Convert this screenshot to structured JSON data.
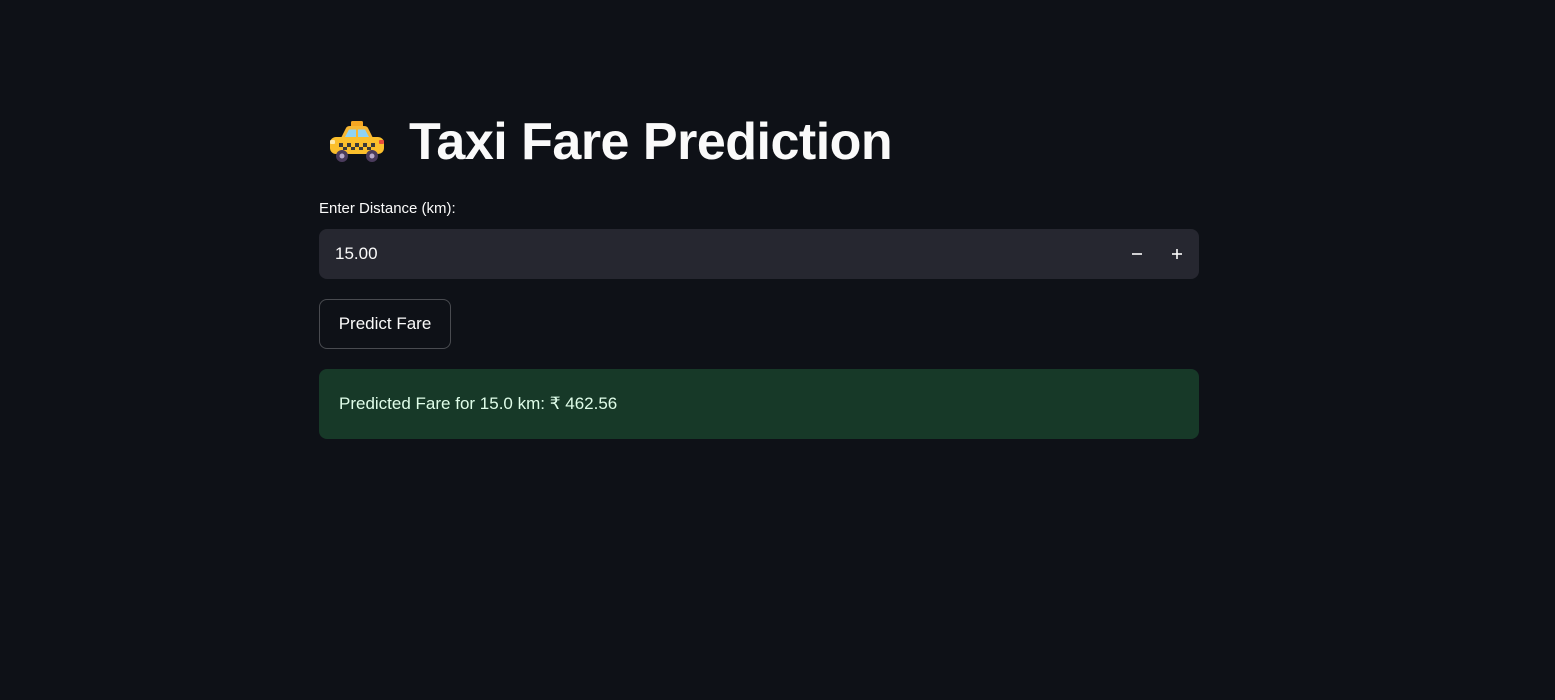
{
  "app": {
    "title": "Taxi Fare Prediction",
    "title_icon": "taxi-icon"
  },
  "distance_input": {
    "label": "Enter Distance (km):",
    "value": "15.00",
    "decrement_icon": "minus-icon",
    "increment_icon": "plus-icon"
  },
  "predict_button": {
    "label": "Predict Fare"
  },
  "result": {
    "text": "Predicted Fare for 15.0 km: ₹ 462.56",
    "color": "#173928"
  },
  "colors": {
    "background": "#0e1117",
    "input_background": "#262730",
    "text": "#fafafa"
  }
}
